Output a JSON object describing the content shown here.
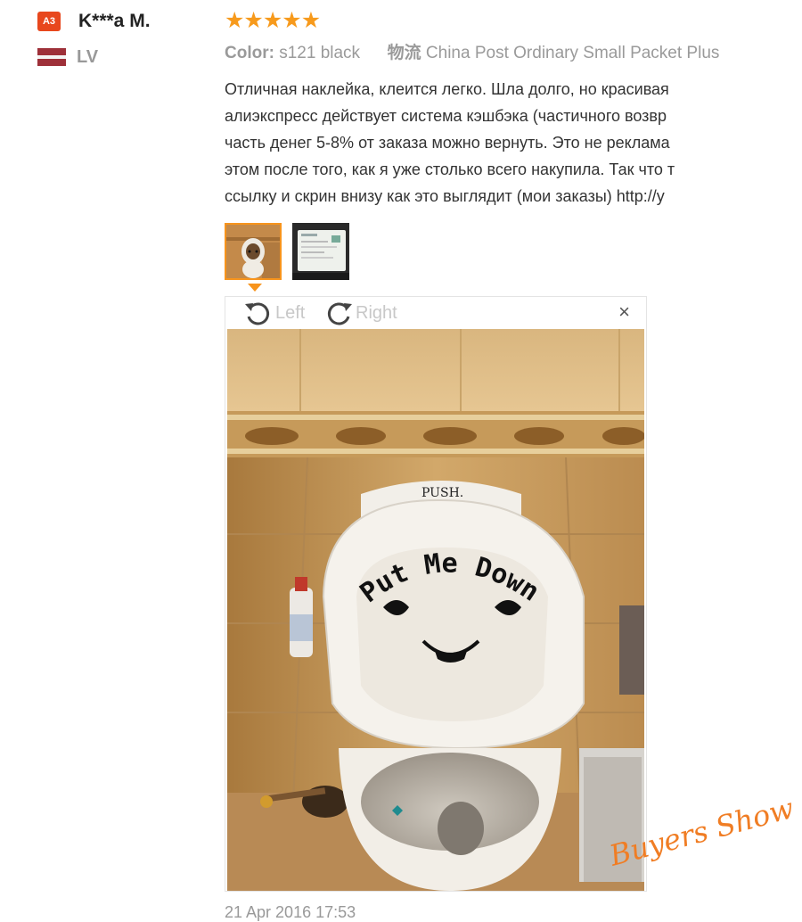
{
  "user": {
    "level_badge": "A3",
    "name": "K***a M.",
    "country": "LV"
  },
  "review": {
    "rating": 5,
    "color_label": "Color:",
    "color_value": "s121 black",
    "shipping_label": "物流",
    "shipping_value": "China Post Ordinary Small Packet Plus",
    "lines": [
      "Отличная наклейка, клеится легко. Шла долго, но красивая",
      "алиэкспресс действует система кэшбэка (частичного возвр",
      "часть денег 5-8% от заказа можно вернуть. Это не реклама",
      "этом после того, как я уже столько всего накупила. Так что т",
      "ссылку и скрин внизу как это выглядит (мои заказы) http://y"
    ],
    "date": "21 Apr 2016 17:53"
  },
  "viewer": {
    "rotate_left": "Left",
    "rotate_right": "Right",
    "close": "×",
    "photo_flush_text": "PUSH.",
    "photo_sticker_text": "Put Me Down",
    "watermark": "Buyers Show"
  },
  "colors": {
    "accent": "#f7941d",
    "star": "#f79a1c",
    "badge": "#e8471d",
    "watermark": "#f07d24"
  },
  "icons": [
    "star-icon",
    "rotate-left-icon",
    "rotate-right-icon",
    "close-icon",
    "latvia-flag-icon"
  ]
}
